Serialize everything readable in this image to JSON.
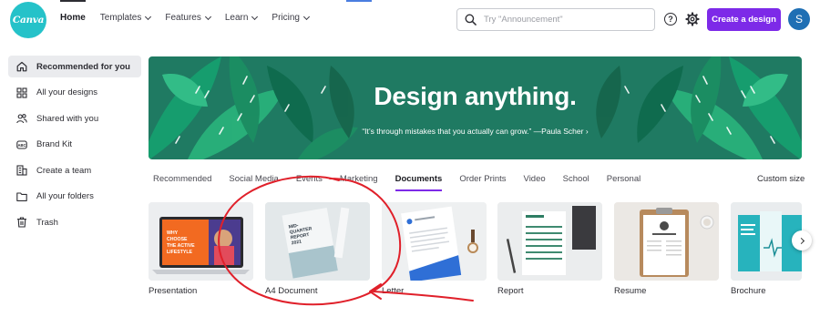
{
  "brand": {
    "logo_text": "Canva",
    "accent": "#7d2ae8",
    "teal": "#25c2c9"
  },
  "nav": {
    "items": [
      {
        "label": "Home",
        "has_menu": false
      },
      {
        "label": "Templates",
        "has_menu": true
      },
      {
        "label": "Features",
        "has_menu": true
      },
      {
        "label": "Learn",
        "has_menu": true
      },
      {
        "label": "Pricing",
        "has_menu": true
      }
    ]
  },
  "search": {
    "placeholder": "Try \"Announcement\"",
    "value": ""
  },
  "header": {
    "help_icon": "?",
    "create_label": "Create a design",
    "avatar_initial": "S"
  },
  "sidebar": {
    "items": [
      {
        "label": "Recommended for you",
        "icon": "home-icon"
      },
      {
        "label": "All your designs",
        "icon": "grid-icon"
      },
      {
        "label": "Shared with you",
        "icon": "people-icon"
      },
      {
        "label": "Brand Kit",
        "icon": "brand-kit-icon"
      },
      {
        "label": "Create a team",
        "icon": "building-icon"
      },
      {
        "label": "All your folders",
        "icon": "folder-icon"
      },
      {
        "label": "Trash",
        "icon": "trash-icon"
      }
    ]
  },
  "hero": {
    "title": "Design anything.",
    "quote": "“It’s through mistakes that you actually can grow.” —Paula Scher ›",
    "bg": "#1f7a62"
  },
  "tabs": {
    "items": [
      "Recommended",
      "Social Media",
      "Events",
      "Marketing",
      "Documents",
      "Order Prints",
      "Video",
      "School",
      "Personal"
    ],
    "active": "Documents",
    "custom_size": "Custom size"
  },
  "cards": {
    "items": [
      {
        "label": "Presentation",
        "thumb_text": "WHY CHOOSE THE ACTIVE LIFESTYLE"
      },
      {
        "label": "A4 Document",
        "thumb_text": "MID-QUARTER REPORT 2021"
      },
      {
        "label": "Letter"
      },
      {
        "label": "Report"
      },
      {
        "label": "Resume"
      },
      {
        "label": "Brochure"
      }
    ]
  },
  "annotation": {
    "circle_color": "#e0202a"
  }
}
